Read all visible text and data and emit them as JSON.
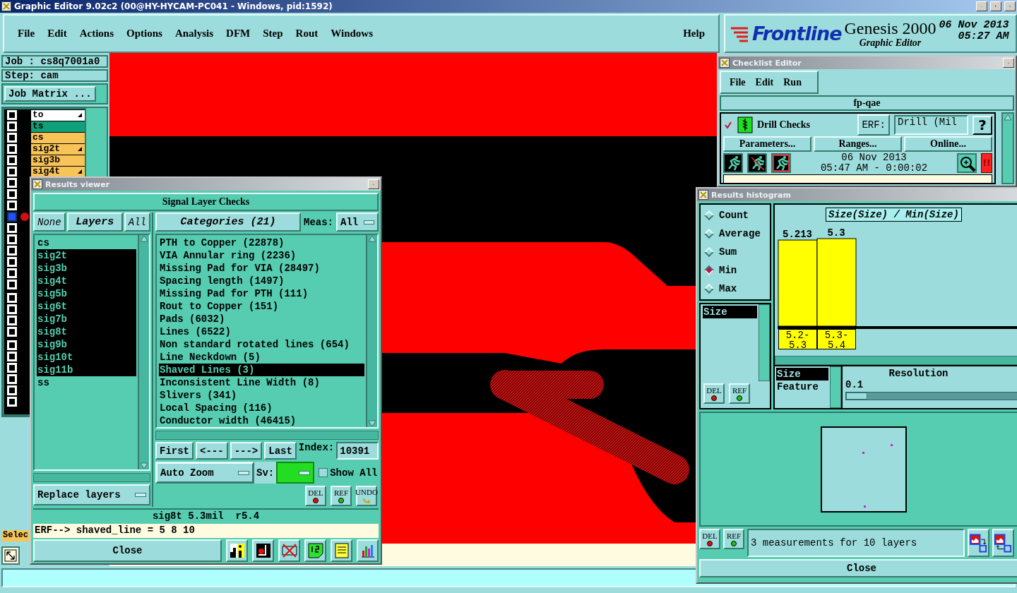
{
  "window": {
    "title": "Graphic Editor 9.02c2 (00@HY-HYCAM-PC041 - Windows, pid:1592)"
  },
  "menu": [
    "File",
    "Edit",
    "Actions",
    "Options",
    "Analysis",
    "DFM",
    "Step",
    "Rout",
    "Windows"
  ],
  "help": "Help",
  "brand": {
    "logo": "Frontline",
    "product": "Genesis 2000",
    "subtitle": "Graphic Editor",
    "date": "06 Nov 2013",
    "time": "05:27 AM"
  },
  "job_panel": {
    "job": "Job : cs8q7001a0",
    "step": "Step: cam",
    "matrix_button": "Job Matrix ...",
    "select_button": "Selec",
    "layer_groups": [
      [
        {
          "name": "to",
          "color": "#ffffff",
          "arrow": true,
          "active": false
        },
        {
          "name": "ts",
          "color": "#10a07a",
          "arrow": false,
          "active": false
        },
        {
          "name": "cs",
          "color": "#f8c458",
          "arrow": false,
          "active": false
        },
        {
          "name": "sig2t",
          "color": "#f8c458",
          "arrow": true,
          "active": false
        },
        {
          "name": "sig3b",
          "color": "#f8c458",
          "arrow": false,
          "active": false
        },
        {
          "name": "sig4t",
          "color": "#f8c458",
          "arrow": true,
          "active": false
        },
        {
          "active": false
        },
        {
          "active": false
        },
        {
          "active": false
        },
        {
          "active": true
        },
        {
          "active": false
        },
        {
          "active": false
        },
        {
          "active": false
        },
        {
          "active": false
        },
        {
          "active": false
        },
        {
          "active": false
        }
      ],
      [
        {
          "active": false
        },
        {
          "active": false
        },
        {
          "active": false
        },
        {
          "active": false
        }
      ],
      [
        {
          "active": false
        },
        {
          "active": false
        },
        {
          "active": false
        },
        {
          "active": false
        },
        {
          "active": false
        },
        {
          "active": false
        }
      ]
    ]
  },
  "results_viewer": {
    "title": "Results viewer",
    "header": "Signal Layer Checks",
    "none_button": "None",
    "layers_label": "Layers",
    "all_button": "All",
    "layers": [
      {
        "name": "cs",
        "selected": false
      },
      {
        "name": "sig2t",
        "selected": true
      },
      {
        "name": "sig3b",
        "selected": true
      },
      {
        "name": "sig4t",
        "selected": true
      },
      {
        "name": "sig5b",
        "selected": true
      },
      {
        "name": "sig6t",
        "selected": true
      },
      {
        "name": "sig7b",
        "selected": true
      },
      {
        "name": "sig8t",
        "selected": true
      },
      {
        "name": "sig9b",
        "selected": true
      },
      {
        "name": "sig10t",
        "selected": true
      },
      {
        "name": "sig11b",
        "selected": true
      },
      {
        "name": "ss",
        "selected": false
      }
    ],
    "categories_button": "Categories (21)",
    "meas_label": "Meas:",
    "meas_value": "All",
    "categories": [
      {
        "label": "PTH to Copper (22878)",
        "selected": false
      },
      {
        "label": "VIA Annular ring (2236)",
        "selected": false
      },
      {
        "label": "Missing Pad for VIA (28497)",
        "selected": false
      },
      {
        "label": "Spacing length (1497)",
        "selected": false
      },
      {
        "label": "Missing Pad for PTH (111)",
        "selected": false
      },
      {
        "label": "Rout to Copper (151)",
        "selected": false
      },
      {
        "label": "Pads (6032)",
        "selected": false
      },
      {
        "label": "Lines (6522)",
        "selected": false
      },
      {
        "label": "Non standard rotated lines (654)",
        "selected": false
      },
      {
        "label": "Line Neckdown (5)",
        "selected": false
      },
      {
        "label": "Shaved Lines (3)",
        "selected": true
      },
      {
        "label": "Inconsistent Line Width (8)",
        "selected": false
      },
      {
        "label": "Slivers (341)",
        "selected": false
      },
      {
        "label": "Local Spacing (116)",
        "selected": false
      },
      {
        "label": "Conductor width (46415)",
        "selected": false
      }
    ],
    "nav_buttons": [
      "First",
      "<---",
      "--->",
      "Last"
    ],
    "index_label": "Index:",
    "index_value": "10391",
    "zoom_mode": "Auto Zoom",
    "sv_label": "Sv:",
    "show_all": {
      "label": "Show All",
      "checked": false
    },
    "replace_mode": "Replace layers",
    "action_buttons": [
      "DEL",
      "REF",
      "UNDO"
    ],
    "info": "sig8t 5.3mil  r5.4",
    "erf_line": "ERF--> shaved_line = 5 8 10",
    "close": "Close"
  },
  "checklist_editor": {
    "title": "Checklist Editor",
    "menu": [
      "File",
      "Edit",
      "Run"
    ],
    "checklist": "fp-qae",
    "check": {
      "name": "Drill Checks",
      "checked": true
    },
    "erf_label": "ERF:",
    "erf_value": "Drill (Mil",
    "help_button": "?",
    "buttons": [
      "Parameters...",
      "Ranges...",
      "Online..."
    ],
    "run_date": "06 Nov 2013",
    "run_time": "05:47 AM - 0:00:02",
    "alert": "!!"
  },
  "results_histogram": {
    "title": "Results histogram",
    "modes": [
      {
        "label": "Count",
        "selected": false
      },
      {
        "label": "Average",
        "selected": false
      },
      {
        "label": "Sum",
        "selected": false
      },
      {
        "label": "Min",
        "selected": true
      },
      {
        "label": "Max",
        "selected": false
      }
    ],
    "fields": [
      {
        "label": "Size",
        "selected": true
      }
    ],
    "chart_data": {
      "type": "bar",
      "title": "Size(Size) / Min(Size)",
      "categories": [
        "5.2-5.3",
        "5.3-5.4"
      ],
      "values": [
        5.213,
        5.3
      ],
      "data_labels": true
    },
    "group_by": [
      {
        "label": "Size",
        "selected": true
      },
      {
        "label": "Feature",
        "selected": false
      }
    ],
    "resolution": {
      "label": "Resolution",
      "value": "0.1",
      "level": 0
    },
    "left_buttons": [
      "DEL",
      "REF"
    ],
    "bottom_buttons": [
      "DEL",
      "REF"
    ],
    "message": "3 measurements for 10 layers",
    "close": "Close"
  }
}
